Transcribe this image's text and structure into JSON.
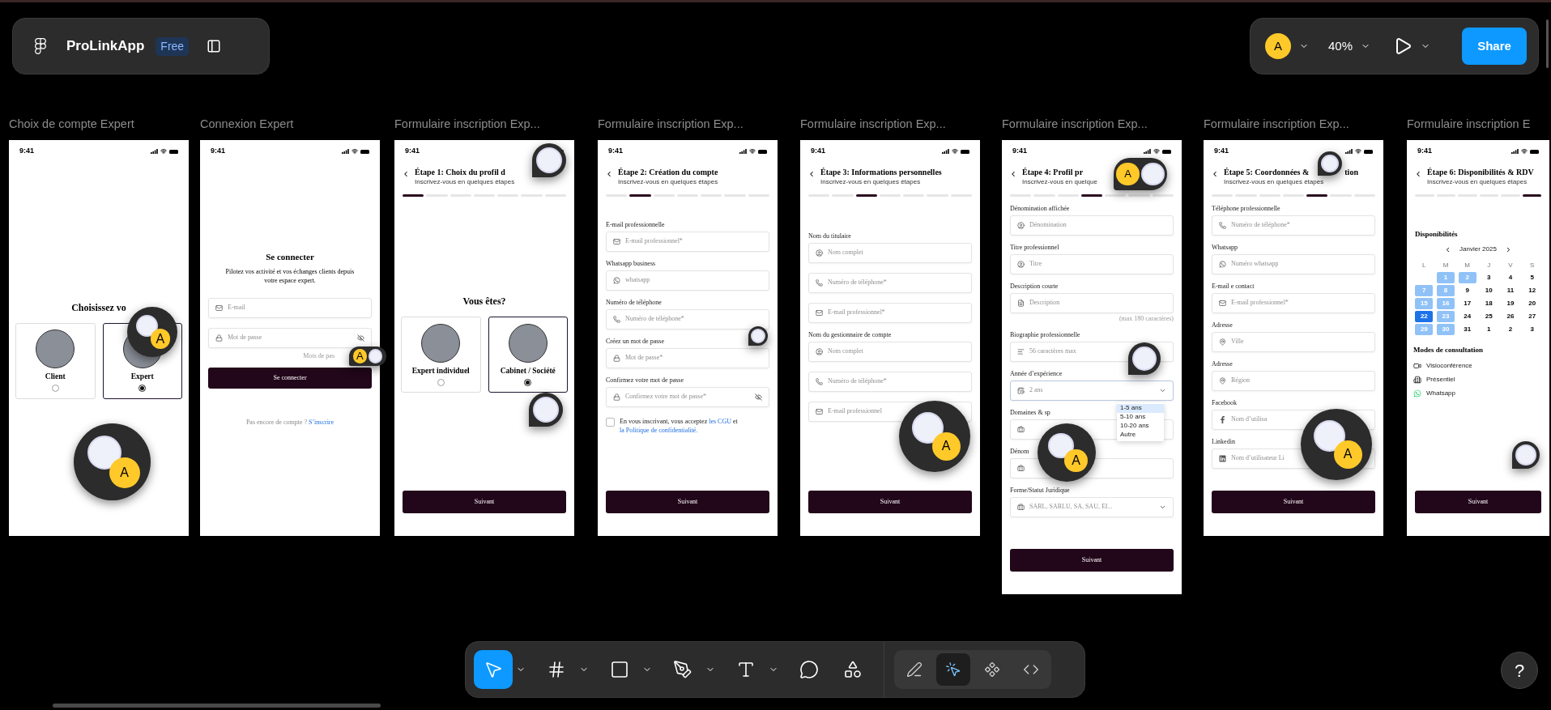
{
  "file": {
    "name": "ProLinkApp",
    "plan": "Free"
  },
  "top": {
    "avatar": "A",
    "zoom": "40%",
    "share": "Share"
  },
  "frames": [
    {
      "kind": "choice",
      "name": "Choix de compte Expert",
      "time": "9:41",
      "heading": "Choisissez vo",
      "options": [
        {
          "label": "Client",
          "selected": false
        },
        {
          "label": "Expert",
          "selected": true
        }
      ],
      "cursors": [
        {
          "kind": "bubble",
          "label": "A"
        },
        {
          "kind": "bubble",
          "label": "A"
        }
      ]
    },
    {
      "kind": "login",
      "name": "Connexion Expert",
      "time": "9:41",
      "heading": "Se connecter",
      "intro": "Pilotez vos activité et vos échanges clients depuis votre espace expert.",
      "fields": [
        {
          "kind": "email",
          "placeholder": "E-mail"
        },
        {
          "kind": "password",
          "placeholder": "Mot de passe",
          "masked": true
        }
      ],
      "forgot": "Mots de pas",
      "login_button": "Se connecter",
      "footer": "Pas encore de compte ? ",
      "link": "S’inscrire",
      "cursors": [
        {
          "kind": "pill",
          "label": "A"
        }
      ]
    },
    {
      "kind": "choice",
      "name": "Formulaire inscription Exp...",
      "time": "9:41",
      "title": "Étape 1: Choix du profil d",
      "subtitle": "Inscrivez-vous en quelques étapes",
      "steps": [
        {
          "selected": true
        },
        {
          "selected": false
        },
        {
          "selected": false
        },
        {
          "selected": false
        },
        {
          "selected": false
        },
        {
          "selected": false
        },
        {
          "selected": false
        }
      ],
      "heading": "Vous êtes?",
      "options": [
        {
          "label": "Expert individuel",
          "selected": false
        },
        {
          "label": "Cabinet / Société",
          "selected": true
        }
      ],
      "button": "Suivant",
      "cursors": [
        {
          "kind": "pin"
        },
        {
          "kind": "pin"
        }
      ]
    },
    {
      "kind": "form",
      "name": "Formulaire inscription Exp...",
      "time": "9:41",
      "title": "Étape 2: Création du compte",
      "subtitle": "Inscrivez-vous en quelques étapes",
      "steps": [
        {
          "selected": false
        },
        {
          "selected": true
        },
        {
          "selected": false
        },
        {
          "selected": false
        },
        {
          "selected": false
        },
        {
          "selected": false
        },
        {
          "selected": false
        }
      ],
      "items": [
        {
          "kind": "email",
          "label": "E-mail professionnelle",
          "placeholder": "E-mail professionnel*"
        },
        {
          "kind": "whatsapp",
          "label": "Whatsapp business",
          "placeholder": "whatsapp"
        },
        {
          "kind": "phone",
          "label": "Numéro de téléphone",
          "placeholder": "Numéro de téléphone*"
        },
        {
          "kind": "password",
          "label": "Créez un mot de passe",
          "placeholder": "Mot de passe*"
        },
        {
          "kind": "password",
          "label": "Confirmez votre mot de passe",
          "placeholder": "Confirmez votre mot de passe*",
          "masked": true
        }
      ],
      "consent": {
        "checked": false,
        "text": "En vous inscrivant, vous acceptez ",
        "link1": "les CGU",
        "middle": " et ",
        "link2": "la Politique de confidentialité."
      },
      "button": "Suivant",
      "cursors": [
        {
          "kind": "pin"
        }
      ]
    },
    {
      "kind": "form",
      "name": "Formulaire inscription Exp...",
      "time": "9:41",
      "title": "Étape 3: Informations personnelles",
      "subtitle": "Inscrivez-vous en quelques étapes",
      "steps": [
        {
          "selected": false
        },
        {
          "selected": false
        },
        {
          "selected": true
        },
        {
          "selected": false
        },
        {
          "selected": false
        },
        {
          "selected": false
        },
        {
          "selected": false
        }
      ],
      "items": [
        {
          "kind": "person",
          "label": "Nom du titulaire",
          "placeholder": "Nom complet"
        },
        {
          "kind": "phone",
          "placeholder": "Numéro de téléphone*"
        },
        {
          "kind": "email",
          "placeholder": "E-mail professionnel*"
        },
        {
          "kind": "person",
          "label": "Nom du gestionnaire de compte",
          "placeholder": "Nom complet"
        },
        {
          "kind": "phone",
          "placeholder": "Numéro de téléphone*"
        },
        {
          "kind": "email",
          "placeholder": "E-mail professionnel"
        }
      ],
      "button": "Suivant",
      "cursors": [
        {
          "kind": "bubble",
          "label": "A"
        }
      ]
    },
    {
      "kind": "form",
      "name": "Formulaire inscription Exp...",
      "time": "9:41",
      "title": "Étape 4: Profil pr",
      "subtitle": "Inscrivez-vous en quelque",
      "steps": [
        {
          "selected": false
        },
        {
          "selected": false
        },
        {
          "selected": false
        },
        {
          "selected": true
        },
        {
          "selected": false
        },
        {
          "selected": false
        },
        {
          "selected": false
        }
      ],
      "items": [
        {
          "kind": "person",
          "label": "Dénomination affichée",
          "placeholder": "Dénomination"
        },
        {
          "kind": "person",
          "label": "Titre professionnel",
          "placeholder": "Titre"
        },
        {
          "kind": "text",
          "label": "Description courte",
          "placeholder": "Description",
          "hint": "(max 180 caractères)"
        },
        {
          "kind": "bio",
          "label": "Biographie professionnelle",
          "placeholder": "56 caractères max"
        },
        {
          "kind": "years",
          "label": "Année d’expérience",
          "placeholder": "2 ans",
          "expanded": true,
          "options": [
            {
              "label": "1-5 ans",
              "selected": true
            },
            {
              "label": "5-10 ans",
              "selected": false
            },
            {
              "label": "10-20 ans",
              "selected": false
            },
            {
              "label": "Autre",
              "selected": false
            }
          ]
        },
        {
          "kind": "business",
          "label": "Domaines & sp"
        },
        {
          "kind": "business",
          "label": "Dénom"
        },
        {
          "kind": "legal",
          "label": "Forme/Statut Juridique",
          "placeholder": "SARL, SARLU, SA, SAU, EI...",
          "expanded": false
        }
      ],
      "button": "Suivant",
      "cursors": [
        {
          "kind": "pill",
          "label": "A"
        },
        {
          "kind": "pin"
        },
        {
          "kind": "bubble",
          "label": "A"
        }
      ]
    },
    {
      "kind": "form",
      "name": "Formulaire inscription Exp...",
      "time": "9:41",
      "title": "Étape 5: Coordonnées &",
      "title_tail": "tion",
      "subtitle": "Inscrivez-vous en quelques étapes",
      "steps": [
        {
          "selected": false
        },
        {
          "selected": false
        },
        {
          "selected": false
        },
        {
          "selected": false
        },
        {
          "selected": true
        },
        {
          "selected": false
        },
        {
          "selected": false
        }
      ],
      "items": [
        {
          "kind": "phone",
          "label": "Téléphone professionnelle",
          "placeholder": "Numéro de téléphone*"
        },
        {
          "kind": "whatsapp",
          "label": "Whatsapp",
          "placeholder": "Numéro whatsapp"
        },
        {
          "kind": "email",
          "label": "E-mail e contact",
          "placeholder": "E-mail professionnel*"
        },
        {
          "kind": "location",
          "label": "Adresse",
          "placeholder": "Ville"
        },
        {
          "kind": "location",
          "label": "Adresse",
          "placeholder": "Région"
        },
        {
          "kind": "facebook",
          "label": "Facebook",
          "placeholder": "Nom d’utilisa"
        },
        {
          "kind": "linkedin",
          "label": "Linkedin",
          "placeholder": "Nom d’utilisateur Li"
        }
      ],
      "button": "Suivant",
      "cursors": [
        {
          "kind": "pin"
        },
        {
          "kind": "bubble",
          "label": "A"
        }
      ]
    },
    {
      "kind": "calendar",
      "name": "Formulaire inscription E",
      "time": "9:41",
      "title": "Étape 6: Disponibilités & RDV",
      "subtitle": "Inscrivez-vous en quelques étapes",
      "steps": [
        {
          "selected": false
        },
        {
          "selected": false
        },
        {
          "selected": false
        },
        {
          "selected": false
        },
        {
          "selected": false
        },
        {
          "selected": true
        }
      ],
      "heading": "Disponibilités",
      "month": "Janvier 2025",
      "weekdays": [
        "L",
        "M",
        "M",
        "J",
        "V",
        "S"
      ],
      "weeks": [
        {
          "days": [
            {
              "d": "1",
              "marked": true,
              "selected": false
            },
            {
              "d": "2",
              "marked": true,
              "selected": false
            },
            {
              "d": "3",
              "marked": false,
              "selected": false
            },
            {
              "d": "4",
              "marked": false,
              "selected": false
            },
            {
              "d": "5",
              "marked": false,
              "selected": false
            }
          ]
        },
        {
          "days": [
            {
              "d": "7",
              "marked": true,
              "selected": false
            },
            {
              "d": "8",
              "marked": true,
              "selected": false
            },
            {
              "d": "9",
              "marked": false,
              "selected": false
            },
            {
              "d": "10",
              "marked": false,
              "selected": false
            },
            {
              "d": "11",
              "marked": false,
              "selected": false
            },
            {
              "d": "12",
              "marked": false,
              "selected": false
            }
          ]
        },
        {
          "days": [
            {
              "d": "15",
              "marked": true,
              "selected": false
            },
            {
              "d": "16",
              "marked": true,
              "selected": false
            },
            {
              "d": "17",
              "marked": false,
              "selected": false
            },
            {
              "d": "18",
              "marked": false,
              "selected": false
            },
            {
              "d": "19",
              "marked": false,
              "selected": false
            },
            {
              "d": "20",
              "marked": false,
              "selected": false
            }
          ]
        },
        {
          "days": [
            {
              "d": "22",
              "marked": false,
              "selected": true
            },
            {
              "d": "23",
              "marked": true,
              "selected": false
            },
            {
              "d": "24",
              "marked": false,
              "selected": false
            },
            {
              "d": "25",
              "marked": false,
              "selected": false
            },
            {
              "d": "26",
              "marked": false,
              "selected": false
            },
            {
              "d": "27",
              "marked": false,
              "selected": false
            }
          ]
        },
        {
          "days": [
            {
              "d": "29",
              "marked": true,
              "selected": false
            },
            {
              "d": "30",
              "marked": true,
              "selected": false
            },
            {
              "d": "31",
              "marked": false,
              "selected": false
            },
            {
              "d": "1",
              "marked": false,
              "selected": false
            },
            {
              "d": "2",
              "marked": false,
              "selected": false
            },
            {
              "d": "3",
              "marked": false,
              "selected": false
            }
          ]
        }
      ],
      "modes_heading": "Modes de consultation",
      "modes": [
        {
          "kind": "video",
          "label": "Visioconférence"
        },
        {
          "kind": "in_person",
          "label": "Présentiel"
        },
        {
          "kind": "whatsapp",
          "label": "Whatsapp"
        }
      ],
      "button": "Suivant",
      "cursors": [
        {
          "kind": "pin"
        }
      ]
    }
  ],
  "tools": [
    {
      "kind": "move",
      "selected": true,
      "menu": true
    },
    {
      "kind": "frame",
      "selected": false,
      "menu": true
    },
    {
      "kind": "shape",
      "selected": false,
      "menu": true
    },
    {
      "kind": "pen",
      "selected": false,
      "menu": true
    },
    {
      "kind": "text",
      "selected": false,
      "menu": true
    },
    {
      "kind": "comment",
      "selected": false,
      "menu": false
    },
    {
      "kind": "actions",
      "selected": false,
      "menu": false
    }
  ],
  "modes": [
    {
      "kind": "draw",
      "selected": false
    },
    {
      "kind": "dev",
      "selected": true
    },
    {
      "kind": "components",
      "selected": false
    },
    {
      "kind": "code",
      "selected": false
    }
  ],
  "help": "?"
}
